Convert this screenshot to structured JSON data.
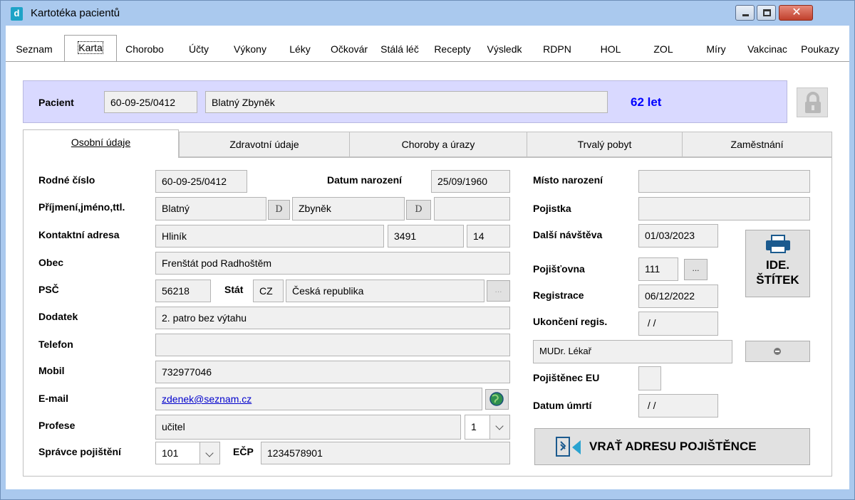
{
  "window": {
    "title": "Kartotéka pacientů"
  },
  "menu_tabs": [
    "Seznam",
    "Karta",
    "Chorobo",
    "Účty",
    "Výkony",
    "Léky",
    "Očkovár",
    "Stálá léč",
    "Recepty",
    "Výsledk",
    "RDPN",
    "HOL",
    "ZOL",
    "Míry",
    "Vakcinac",
    "Poukazy"
  ],
  "patient": {
    "label": "Pacient",
    "rc": "60-09-25/0412",
    "name": "Blatný Zbyněk",
    "age": "62 let"
  },
  "sub_tabs": [
    "Osobní údaje",
    "Zdravotní údaje",
    "Choroby a úrazy",
    "Trvalý pobyt",
    "Zaměstnání"
  ],
  "form": {
    "rodne_cislo": {
      "label": "Rodné číslo",
      "value": "60-09-25/0412"
    },
    "datum_narozeni": {
      "label": "Datum narození",
      "value": "25/09/1960"
    },
    "prijmeni": {
      "label": "Příjmení,jméno,ttl.",
      "surname": "Blatný",
      "firstname": "Zbyněk",
      "title": "",
      "d_label": "D"
    },
    "adresa": {
      "label": "Kontaktní adresa",
      "street": "Hliník",
      "number": "3491",
      "orient": "14"
    },
    "obec": {
      "label": "Obec",
      "value": "Frenštát pod Radhoštěm"
    },
    "psc": {
      "label": "PSČ",
      "value": "56218"
    },
    "stat": {
      "label": "Stát",
      "code": "CZ",
      "name": "Česká republika",
      "btn": "..."
    },
    "dodatek": {
      "label": "Dodatek",
      "value": "2. patro bez výtahu"
    },
    "telefon": {
      "label": "Telefon",
      "value": ""
    },
    "mobil": {
      "label": "Mobil",
      "value": "732977046"
    },
    "email": {
      "label": "E-mail",
      "value": "zdenek@seznam.cz"
    },
    "profese": {
      "label": "Profese",
      "value": "učitel",
      "code": "1"
    },
    "spravce": {
      "label": "Správce pojištění",
      "value": "101"
    },
    "ecp": {
      "label": "EČP",
      "value": "1234578901"
    },
    "misto_narozeni": {
      "label": "Místo narození",
      "value": ""
    },
    "pojistka": {
      "label": "Pojistka",
      "value": ""
    },
    "dalsi_navsteva": {
      "label": "Další návštěva",
      "value": "01/03/2023"
    },
    "pojistovna": {
      "label": "Pojišťovna",
      "value": "111",
      "btn": "..."
    },
    "registrace": {
      "label": "Registrace",
      "value": "06/12/2022"
    },
    "ukonceni": {
      "label": "Ukončení regis.",
      "value": " / /"
    },
    "lekar": {
      "value": "MUDr. Lékař"
    },
    "pojistenec_eu": {
      "label": "Pojištěnec EU",
      "value": ""
    },
    "datum_umrti": {
      "label": "Datum úmrtí",
      "value": " / /"
    }
  },
  "buttons": {
    "print_line1": "IDE.",
    "print_line2": "ŠTÍTEK",
    "return_address": "VRAŤ ADRESU POJIŠTĚNCE"
  },
  "colors": {
    "patient_panel": "#d9d9ff",
    "age": "#0000ff",
    "link": "#0000cc"
  }
}
